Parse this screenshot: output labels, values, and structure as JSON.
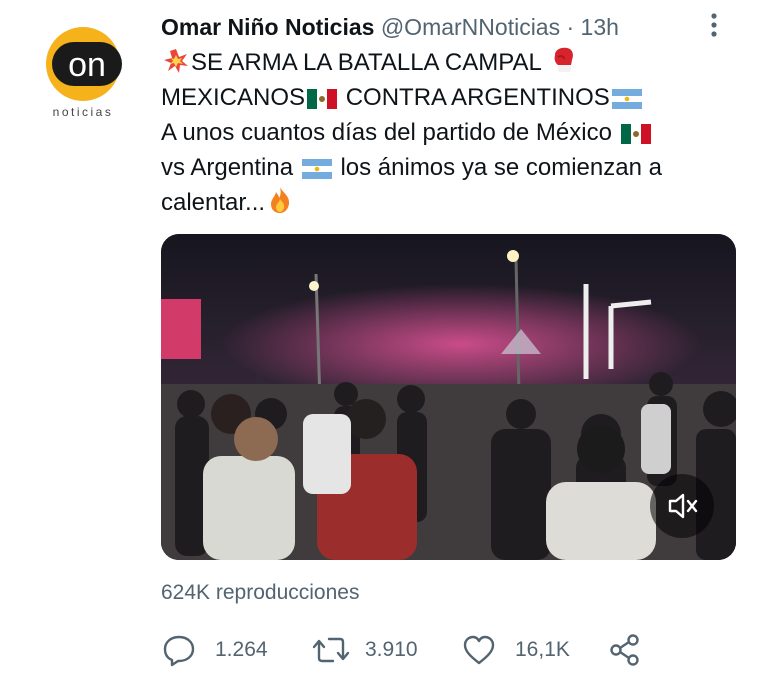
{
  "author": {
    "display_name": "Omar Niño Noticias",
    "handle": "@OmarNNoticias",
    "separator": "·",
    "time": "13h",
    "avatar": {
      "logo_text": "on",
      "sub_text": "noticias",
      "color": "#f5b21a"
    }
  },
  "tweet": {
    "line1": "SE ARMA LA BATALLA CAMPAL",
    "line2": "MEXICANOS",
    "line2b": "CONTRA ARGENTINOS",
    "line3": "A unos cuantos días del partido de México",
    "line4a": "vs Argentina",
    "line4b": "los ánimos ya se comienzan a",
    "line5": "calentar...",
    "emojis": [
      "collision-emoji",
      "boxing-glove-emoji",
      "mexico-flag-emoji",
      "argentina-flag-emoji",
      "fire-emoji"
    ]
  },
  "media": {
    "type": "video",
    "mute_icon": "volume-muted-icon"
  },
  "stats": {
    "views_label": "624K reproducciones"
  },
  "actions": {
    "replies": "1.264",
    "retweets": "3.910",
    "likes": "16,1K"
  },
  "colors": {
    "text": "#0f1419",
    "secondary": "#536471"
  }
}
